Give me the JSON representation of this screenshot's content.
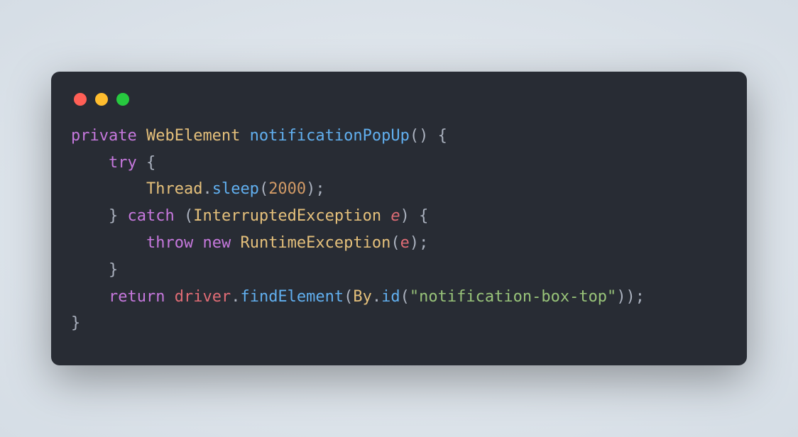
{
  "window": {
    "dots": {
      "red": "#ff5f56",
      "yellow": "#ffbd2e",
      "green": "#27c93f"
    }
  },
  "code": {
    "tokens": [
      [
        {
          "t": "private",
          "c": "c-keyword"
        },
        {
          "t": " ",
          "c": ""
        },
        {
          "t": "WebElement",
          "c": "c-type"
        },
        {
          "t": " ",
          "c": ""
        },
        {
          "t": "notificationPopUp",
          "c": "c-func"
        },
        {
          "t": "()",
          "c": "c-punc"
        },
        {
          "t": " ",
          "c": ""
        },
        {
          "t": "{",
          "c": "c-punc"
        }
      ],
      [
        {
          "t": "    ",
          "c": ""
        },
        {
          "t": "try",
          "c": "c-keyword"
        },
        {
          "t": " ",
          "c": ""
        },
        {
          "t": "{",
          "c": "c-punc"
        }
      ],
      [
        {
          "t": "        ",
          "c": ""
        },
        {
          "t": "Thread",
          "c": "c-type"
        },
        {
          "t": ".",
          "c": "c-punc"
        },
        {
          "t": "sleep",
          "c": "c-call"
        },
        {
          "t": "(",
          "c": "c-punc"
        },
        {
          "t": "2000",
          "c": "c-num"
        },
        {
          "t": ");",
          "c": "c-punc"
        }
      ],
      [
        {
          "t": "    ",
          "c": ""
        },
        {
          "t": "}",
          "c": "c-punc"
        },
        {
          "t": " ",
          "c": ""
        },
        {
          "t": "catch",
          "c": "c-keyword"
        },
        {
          "t": " ",
          "c": ""
        },
        {
          "t": "(",
          "c": "c-punc"
        },
        {
          "t": "InterruptedException",
          "c": "c-type"
        },
        {
          "t": " ",
          "c": ""
        },
        {
          "t": "e",
          "c": "c-param-it"
        },
        {
          "t": ")",
          "c": "c-punc"
        },
        {
          "t": " ",
          "c": ""
        },
        {
          "t": "{",
          "c": "c-punc"
        }
      ],
      [
        {
          "t": "        ",
          "c": ""
        },
        {
          "t": "throw",
          "c": "c-keyword"
        },
        {
          "t": " ",
          "c": ""
        },
        {
          "t": "new",
          "c": "c-keyword"
        },
        {
          "t": " ",
          "c": ""
        },
        {
          "t": "RuntimeException",
          "c": "c-type"
        },
        {
          "t": "(",
          "c": "c-punc"
        },
        {
          "t": "e",
          "c": "c-var"
        },
        {
          "t": ");",
          "c": "c-punc"
        }
      ],
      [
        {
          "t": "    ",
          "c": ""
        },
        {
          "t": "}",
          "c": "c-punc"
        }
      ],
      [
        {
          "t": "    ",
          "c": ""
        },
        {
          "t": "return",
          "c": "c-keyword"
        },
        {
          "t": " ",
          "c": ""
        },
        {
          "t": "driver",
          "c": "c-var"
        },
        {
          "t": ".",
          "c": "c-punc"
        },
        {
          "t": "findElement",
          "c": "c-call"
        },
        {
          "t": "(",
          "c": "c-punc"
        },
        {
          "t": "By",
          "c": "c-type"
        },
        {
          "t": ".",
          "c": "c-punc"
        },
        {
          "t": "id",
          "c": "c-call"
        },
        {
          "t": "(",
          "c": "c-punc"
        },
        {
          "t": "\"notification-box-top\"",
          "c": "c-str"
        },
        {
          "t": "));",
          "c": "c-punc"
        }
      ],
      [
        {
          "t": "}",
          "c": "c-punc"
        }
      ]
    ]
  }
}
